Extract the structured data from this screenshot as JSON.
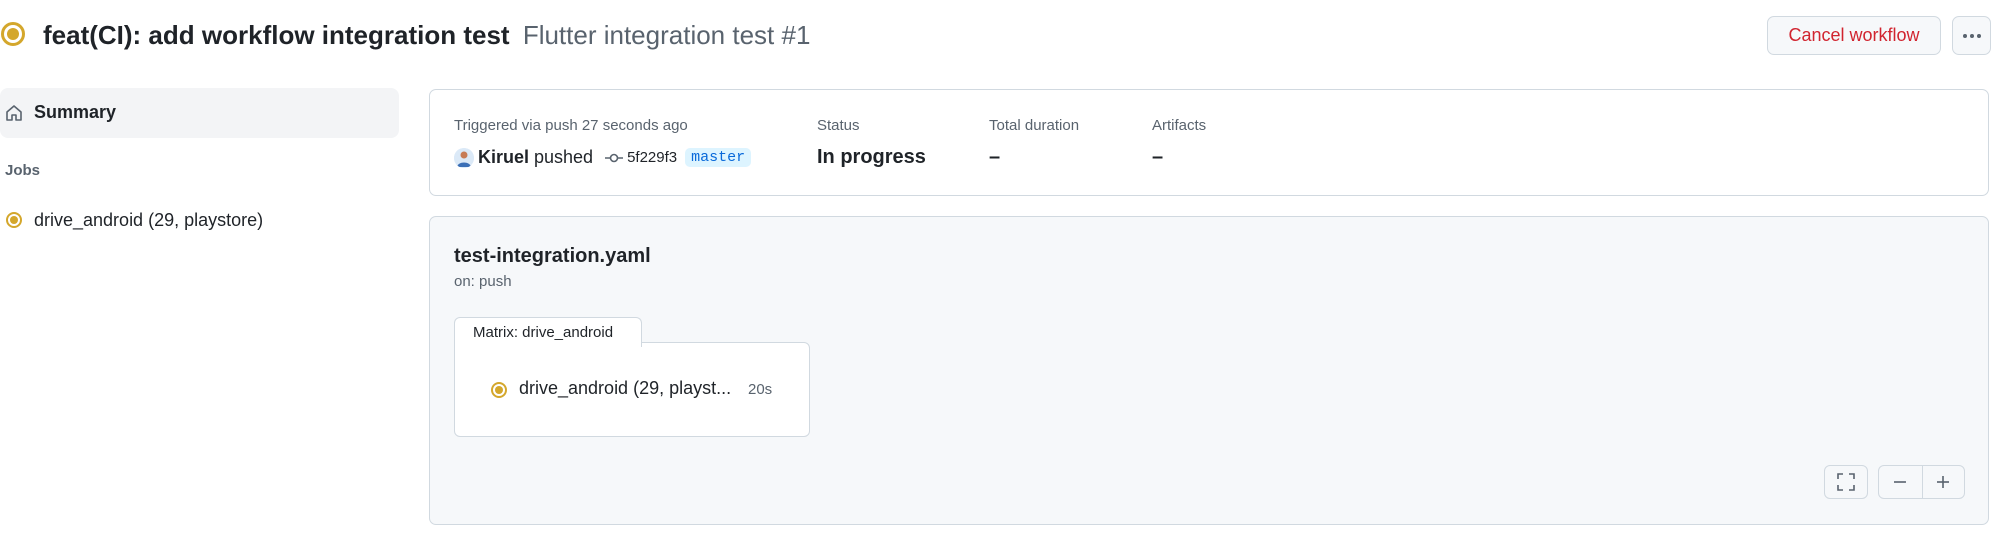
{
  "header": {
    "title": "feat(CI): add workflow integration test",
    "subtitle": "Flutter integration test #1",
    "cancel_label": "Cancel workflow",
    "status_icon": "in-progress-ring-icon",
    "more_icon": "kebab-horizontal-icon"
  },
  "sidebar": {
    "summary_label": "Summary",
    "summary_icon": "home-icon",
    "jobs_heading": "Jobs",
    "jobs": [
      {
        "label": "drive_android (29, playstore)",
        "status": "in_progress",
        "icon": "in-progress-dot-icon"
      }
    ]
  },
  "summary": {
    "triggered_label": "Triggered via push 27 seconds ago",
    "actor": "Kiruel",
    "action": "pushed",
    "commit_sha": "5f229f3",
    "branch": "master",
    "status_label": "Status",
    "status_value": "In progress",
    "duration_label": "Total duration",
    "duration_value": "–",
    "artifacts_label": "Artifacts",
    "artifacts_value": "–"
  },
  "graph": {
    "workflow_file": "test-integration.yaml",
    "trigger": "on: push",
    "matrix_label": "Matrix: drive_android",
    "job_name": "drive_android (29, playst...",
    "job_duration": "20s",
    "controls": [
      "fullscreen-icon",
      "zoom-out-icon",
      "zoom-in-icon"
    ]
  },
  "colors": {
    "in_progress": "#d4a72c",
    "danger": "#d1242f",
    "accent": "#0969da",
    "border": "#d1d9e0",
    "muted": "#59636e"
  }
}
